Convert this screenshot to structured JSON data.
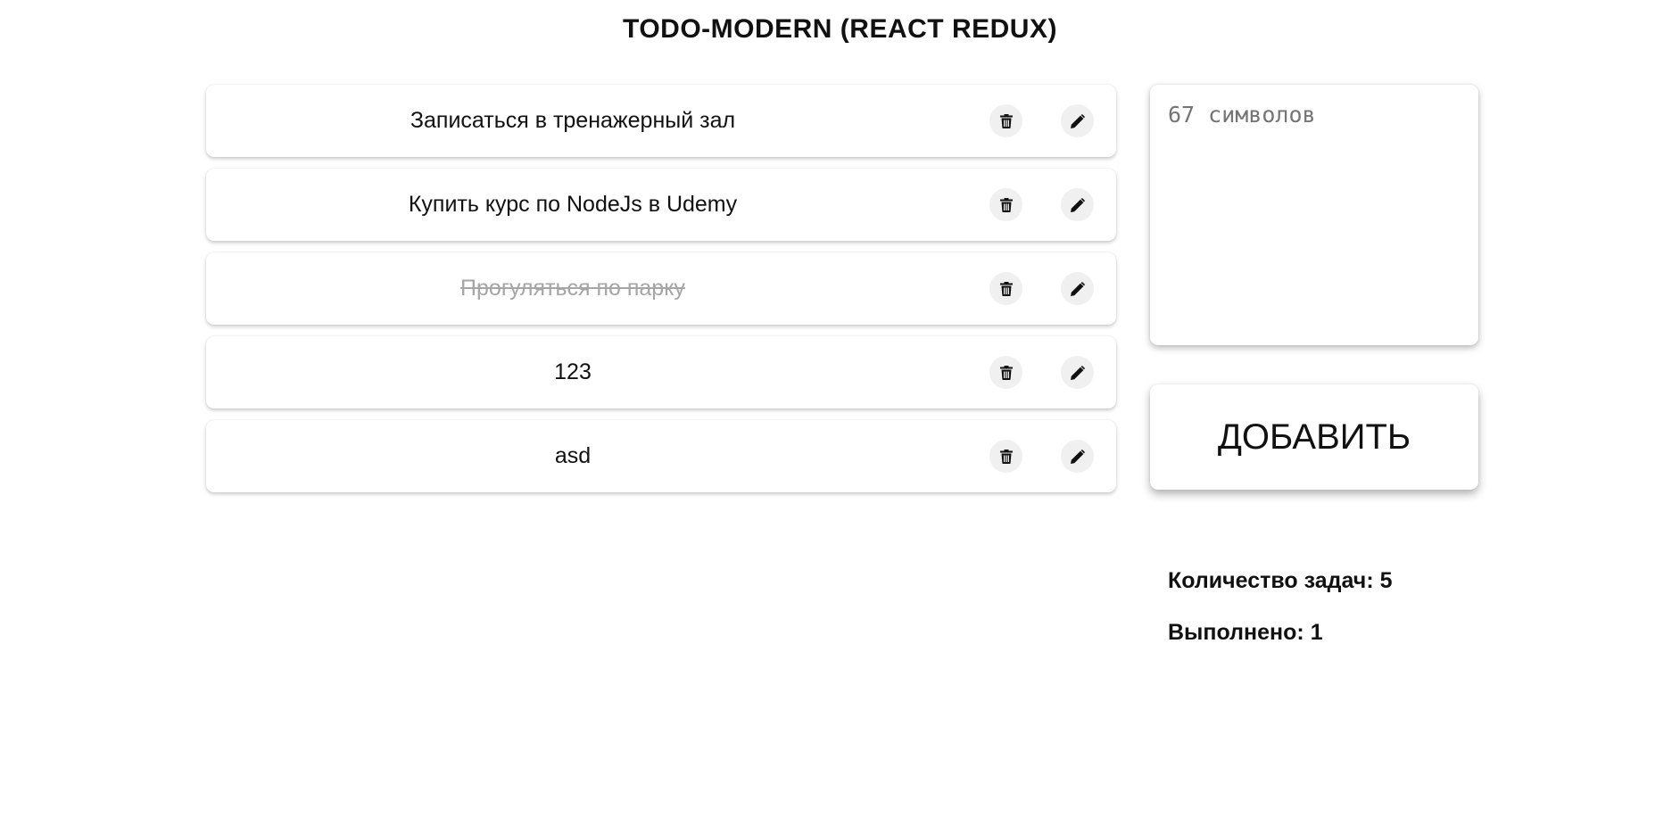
{
  "header": {
    "title": "TODO-MODERN (REACT REDUX)"
  },
  "todos": [
    {
      "text": "Записаться в тренажерный зал",
      "completed": false
    },
    {
      "text": "Купить курс по NodeJs в Udemy",
      "completed": false
    },
    {
      "text": "Прогуляться по парку",
      "completed": true
    },
    {
      "text": "123",
      "completed": false
    },
    {
      "text": "asd",
      "completed": false
    }
  ],
  "icons": {
    "delete": "trash-icon",
    "edit": "pencil-icon"
  },
  "form": {
    "placeholder": "67 символов",
    "value": "",
    "add_label": "ДОБАВИТЬ"
  },
  "stats": {
    "total_label": "Количество задач:",
    "total": "5",
    "done_label": "Выполнено:",
    "done": "1"
  },
  "colors": {
    "background": "#ffffff",
    "text": "#111111",
    "completed_text": "#a6a6a6",
    "icon_button_bg": "#f0f0f0"
  }
}
